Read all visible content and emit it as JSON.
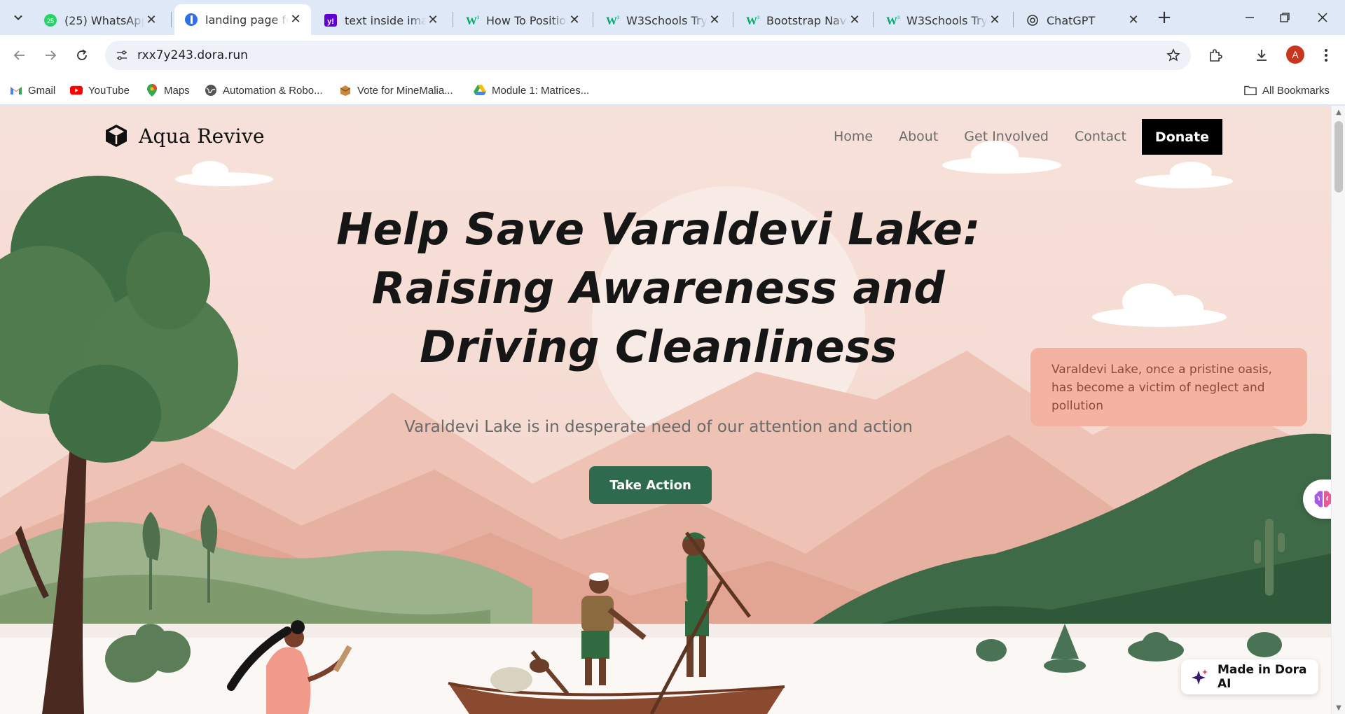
{
  "browser": {
    "tabs": [
      {
        "label": "(25) WhatsApp",
        "icon": "whatsapp-icon",
        "active": false
      },
      {
        "label": "landing page for",
        "icon": "dora-icon",
        "active": true
      },
      {
        "label": "text inside image",
        "icon": "yahoo-icon",
        "active": false
      },
      {
        "label": "How To Position",
        "icon": "w3schools-icon",
        "active": false
      },
      {
        "label": "W3Schools Tryit",
        "icon": "w3schools-icon",
        "active": false
      },
      {
        "label": "Bootstrap Navig",
        "icon": "w3schools-icon",
        "active": false
      },
      {
        "label": "W3Schools Tryit",
        "icon": "w3schools-icon",
        "active": false
      },
      {
        "label": "ChatGPT",
        "icon": "chatgpt-icon",
        "active": false
      }
    ],
    "whatsapp_badge": "25",
    "url": "rxx7y243.dora.run",
    "profile_initial": "A",
    "bookmarks": [
      {
        "label": "Gmail",
        "icon": "gmail-icon"
      },
      {
        "label": "YouTube",
        "icon": "youtube-icon"
      },
      {
        "label": "Maps",
        "icon": "maps-icon"
      },
      {
        "label": "Automation & Robo...",
        "icon": "globe-icon"
      },
      {
        "label": "Vote for MineMalia...",
        "icon": "minemalia-icon"
      },
      {
        "label": "Module 1: Matrices...",
        "icon": "google-drive-icon"
      }
    ],
    "all_bookmarks": "All Bookmarks"
  },
  "site": {
    "brand": "Aqua Revive",
    "nav": [
      "Home",
      "About",
      "Get Involved",
      "Contact"
    ],
    "donate": "Donate",
    "hero_title_lines": [
      "Help Save Varaldevi Lake:",
      "Raising Awareness and",
      "Driving Cleanliness"
    ],
    "hero_subtitle": "Varaldevi Lake is in desperate need of our attention and action",
    "cta": "Take Action",
    "info_card": "Varaldevi Lake, once a pristine oasis, has become a victim of neglect and pollution",
    "badge": "Made in Dora AI"
  },
  "colors": {
    "sky": "#f7e3dc",
    "cta_green": "#2e6a4e",
    "info_card_bg": "#f4b2a0",
    "donate_bg": "#000000"
  }
}
